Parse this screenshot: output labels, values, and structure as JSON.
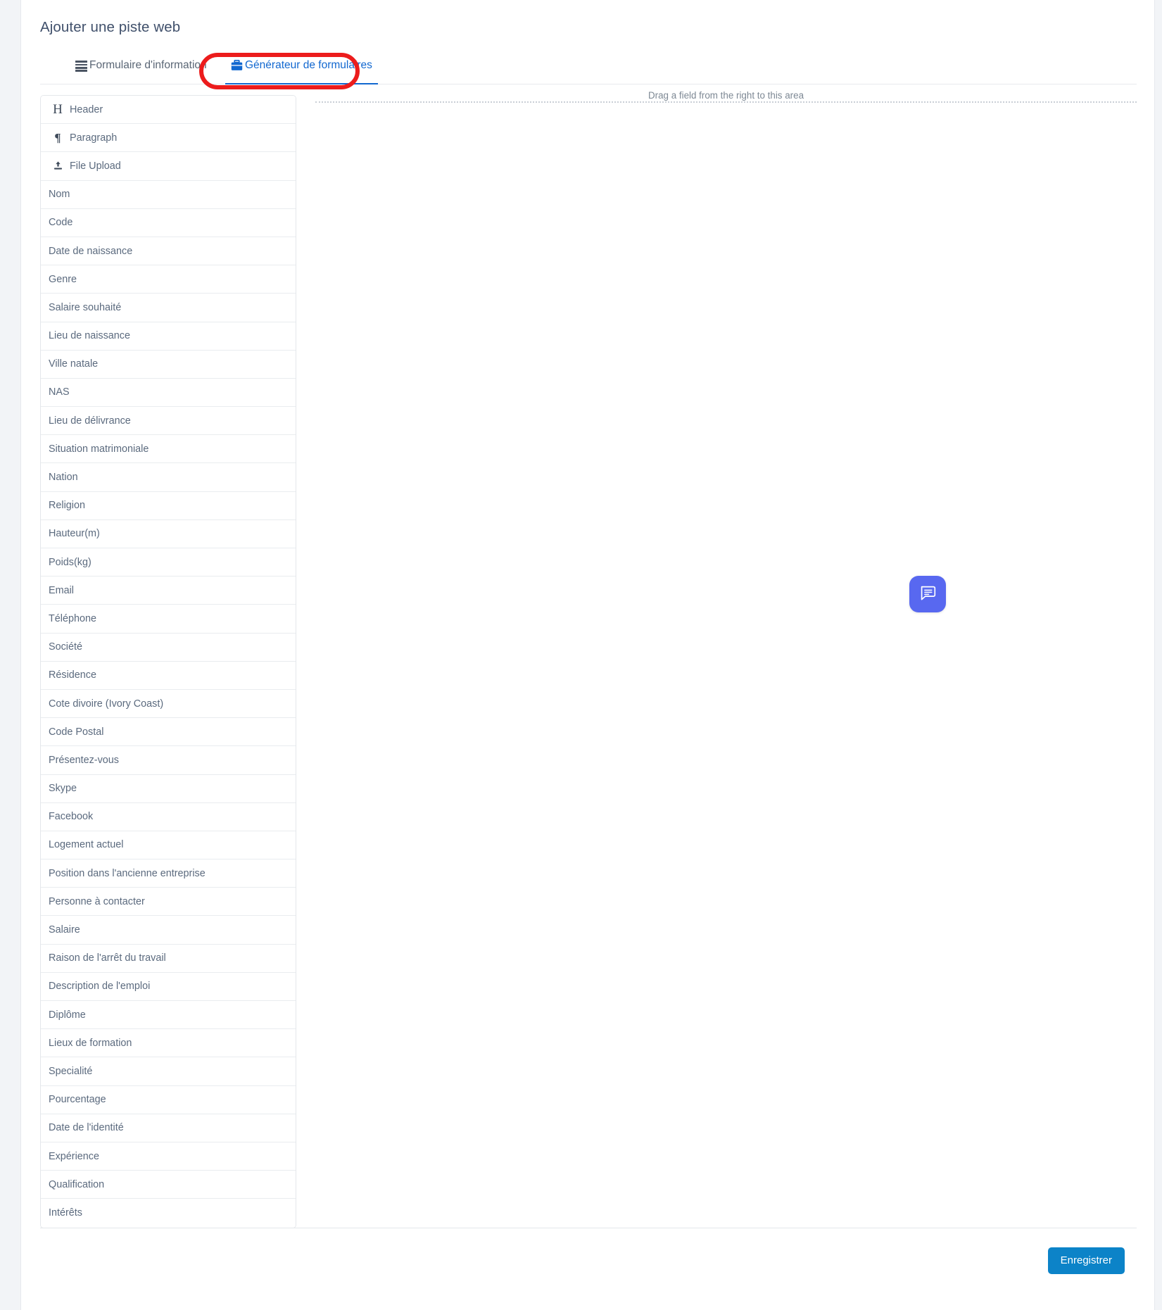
{
  "page": {
    "title": "Ajouter une piste web"
  },
  "tabs": [
    {
      "label": "Formulaire d'information",
      "icon": "bars-icon",
      "active": false
    },
    {
      "label": "Générateur de formulaires",
      "icon": "briefcase-icon",
      "active": true
    }
  ],
  "dropzone": {
    "text": "Drag a field from the right to this area"
  },
  "palette": {
    "items": [
      {
        "label": "Header",
        "icon": "heading-icon"
      },
      {
        "label": "Paragraph",
        "icon": "paragraph-icon"
      },
      {
        "label": "File Upload",
        "icon": "upload-icon"
      },
      {
        "label": "Nom",
        "icon": ""
      },
      {
        "label": "Code",
        "icon": ""
      },
      {
        "label": "Date de naissance",
        "icon": ""
      },
      {
        "label": "Genre",
        "icon": ""
      },
      {
        "label": "Salaire souhaité",
        "icon": ""
      },
      {
        "label": "Lieu de naissance",
        "icon": ""
      },
      {
        "label": "Ville natale",
        "icon": ""
      },
      {
        "label": "NAS",
        "icon": ""
      },
      {
        "label": "Lieu de délivrance",
        "icon": ""
      },
      {
        "label": "Situation matrimoniale",
        "icon": ""
      },
      {
        "label": "Nation",
        "icon": ""
      },
      {
        "label": "Religion",
        "icon": ""
      },
      {
        "label": "Hauteur(m)",
        "icon": ""
      },
      {
        "label": "Poids(kg)",
        "icon": ""
      },
      {
        "label": "Email",
        "icon": ""
      },
      {
        "label": "Téléphone",
        "icon": ""
      },
      {
        "label": "Société",
        "icon": ""
      },
      {
        "label": "Résidence",
        "icon": ""
      },
      {
        "label": "Cote divoire (Ivory Coast)",
        "icon": ""
      },
      {
        "label": "Code Postal",
        "icon": ""
      },
      {
        "label": "Présentez-vous",
        "icon": ""
      },
      {
        "label": "Skype",
        "icon": ""
      },
      {
        "label": "Facebook",
        "icon": ""
      },
      {
        "label": "Logement actuel",
        "icon": ""
      },
      {
        "label": "Position dans l'ancienne entreprise",
        "icon": ""
      },
      {
        "label": "Personne à contacter",
        "icon": ""
      },
      {
        "label": "Salaire",
        "icon": ""
      },
      {
        "label": "Raison de l'arrêt du travail",
        "icon": ""
      },
      {
        "label": "Description de l'emploi",
        "icon": ""
      },
      {
        "label": "Diplôme",
        "icon": ""
      },
      {
        "label": "Lieux de formation",
        "icon": ""
      },
      {
        "label": "Specialité",
        "icon": ""
      },
      {
        "label": "Pourcentage",
        "icon": ""
      },
      {
        "label": "Date de l'identité",
        "icon": ""
      },
      {
        "label": "Expérience",
        "icon": ""
      },
      {
        "label": "Qualification",
        "icon": ""
      },
      {
        "label": "Intérêts",
        "icon": ""
      }
    ]
  },
  "footer": {
    "save_label": "Enregistrer"
  },
  "chat": {
    "icon": "chat-bubble-icon"
  },
  "annotation": {
    "shape": "ellipse",
    "color": "#ec1c1c",
    "targets": "tab-generateur-de-formulaires"
  },
  "colors": {
    "accent_blue": "#1268d0",
    "save_button": "#0c83c8",
    "chat_widget": "#5868f0",
    "annotation_red": "#ec1c1c",
    "text_muted": "#5b6a7e",
    "page_bg": "#f2f4f7"
  }
}
